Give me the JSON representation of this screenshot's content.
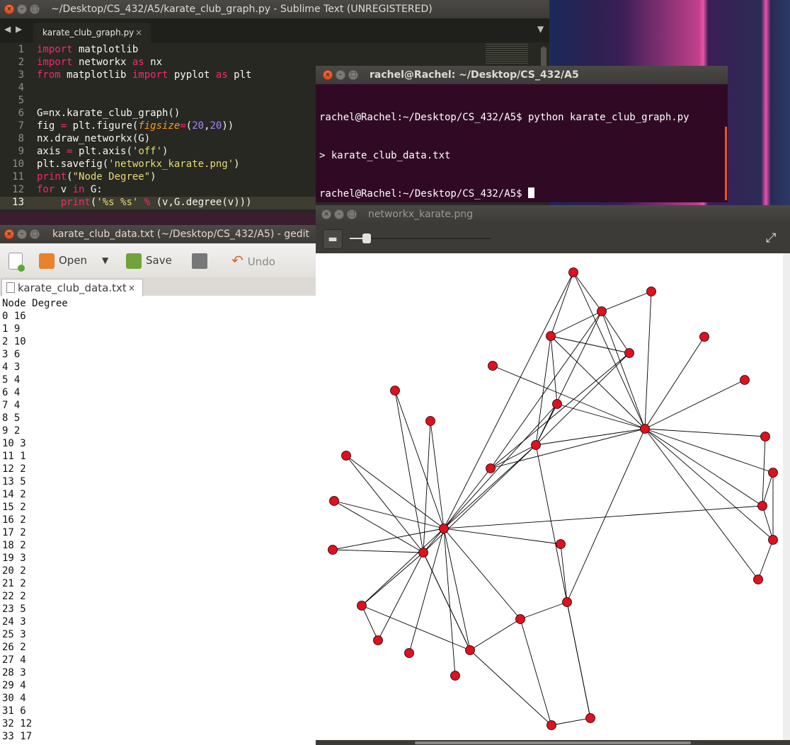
{
  "sublime": {
    "title": "~/Desktop/CS_432/A5/karate_club_graph.py - Sublime Text (UNREGISTERED)",
    "tab_label": "karate_club_graph.py",
    "tab_close": "×",
    "line_numbers": [
      "1",
      "2",
      "3",
      "4",
      "5",
      "6",
      "7",
      "8",
      "9",
      "10",
      "11",
      "12",
      "13"
    ]
  },
  "terminal": {
    "title": "rachel@Rachel: ~/Desktop/CS_432/A5",
    "lines": [
      "rachel@Rachel:~/Desktop/CS_432/A5$ python karate_club_graph.py",
      "> karate_club_data.txt",
      "rachel@Rachel:~/Desktop/CS_432/A5$ "
    ]
  },
  "gedit": {
    "title": "karate_club_data.txt (~/Desktop/CS_432/A5) - gedit",
    "toolbar": {
      "open": "Open",
      "save": "Save",
      "undo": "Undo"
    },
    "tab_label": "karate_club_data.txt",
    "tab_close": "×",
    "content": "Node Degree\n0 16\n1 9\n2 10\n3 6\n4 3\n5 4\n6 4\n7 4\n8 5\n9 2\n10 3\n11 1\n12 2\n13 5\n14 2\n15 2\n16 2\n17 2\n18 2\n19 3\n20 2\n21 2\n22 2\n23 5\n24 3\n25 3\n26 2\n27 4\n28 3\n29 4\n30 4\n31 6\n32 12\n33 17"
  },
  "viewer": {
    "title": "networkx_karate.png",
    "zoom_fraction": 0.12
  },
  "colors": {
    "node_fill": "#e0101e",
    "terminal_bg": "#300a24",
    "sublime_bg": "#272822"
  }
}
